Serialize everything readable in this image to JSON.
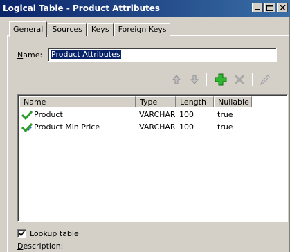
{
  "window": {
    "title": "Logical Table - Product Attributes",
    "minimize_label": "_",
    "maximize_label": "□",
    "close_label": "×"
  },
  "tabs": [
    {
      "label": "General",
      "active": true
    },
    {
      "label": "Sources",
      "active": false
    },
    {
      "label": "Keys",
      "active": false
    },
    {
      "label": "Foreign Keys",
      "active": false
    }
  ],
  "form": {
    "name_label_underlined": "N",
    "name_label_rest": "ame:",
    "name_value": "Product Attributes"
  },
  "toolbar": {
    "icons": [
      "arrow-up-icon",
      "arrow-down-icon",
      "add-icon",
      "delete-icon",
      "edit-icon"
    ]
  },
  "grid": {
    "columns": [
      "Name",
      "Type",
      "Length",
      "Nullable"
    ],
    "rows": [
      {
        "name": "Product",
        "type": "VARCHAR",
        "length": "100",
        "nullable": "true",
        "icon": "check-icon"
      },
      {
        "name": "Product Min Price",
        "type": "VARCHAR",
        "length": "100",
        "nullable": "true",
        "icon": "check-edit-icon"
      }
    ]
  },
  "lookup": {
    "label": "Lookup table",
    "checked": true
  },
  "description": {
    "label_underlined": "D",
    "label_rest": "escription:"
  }
}
